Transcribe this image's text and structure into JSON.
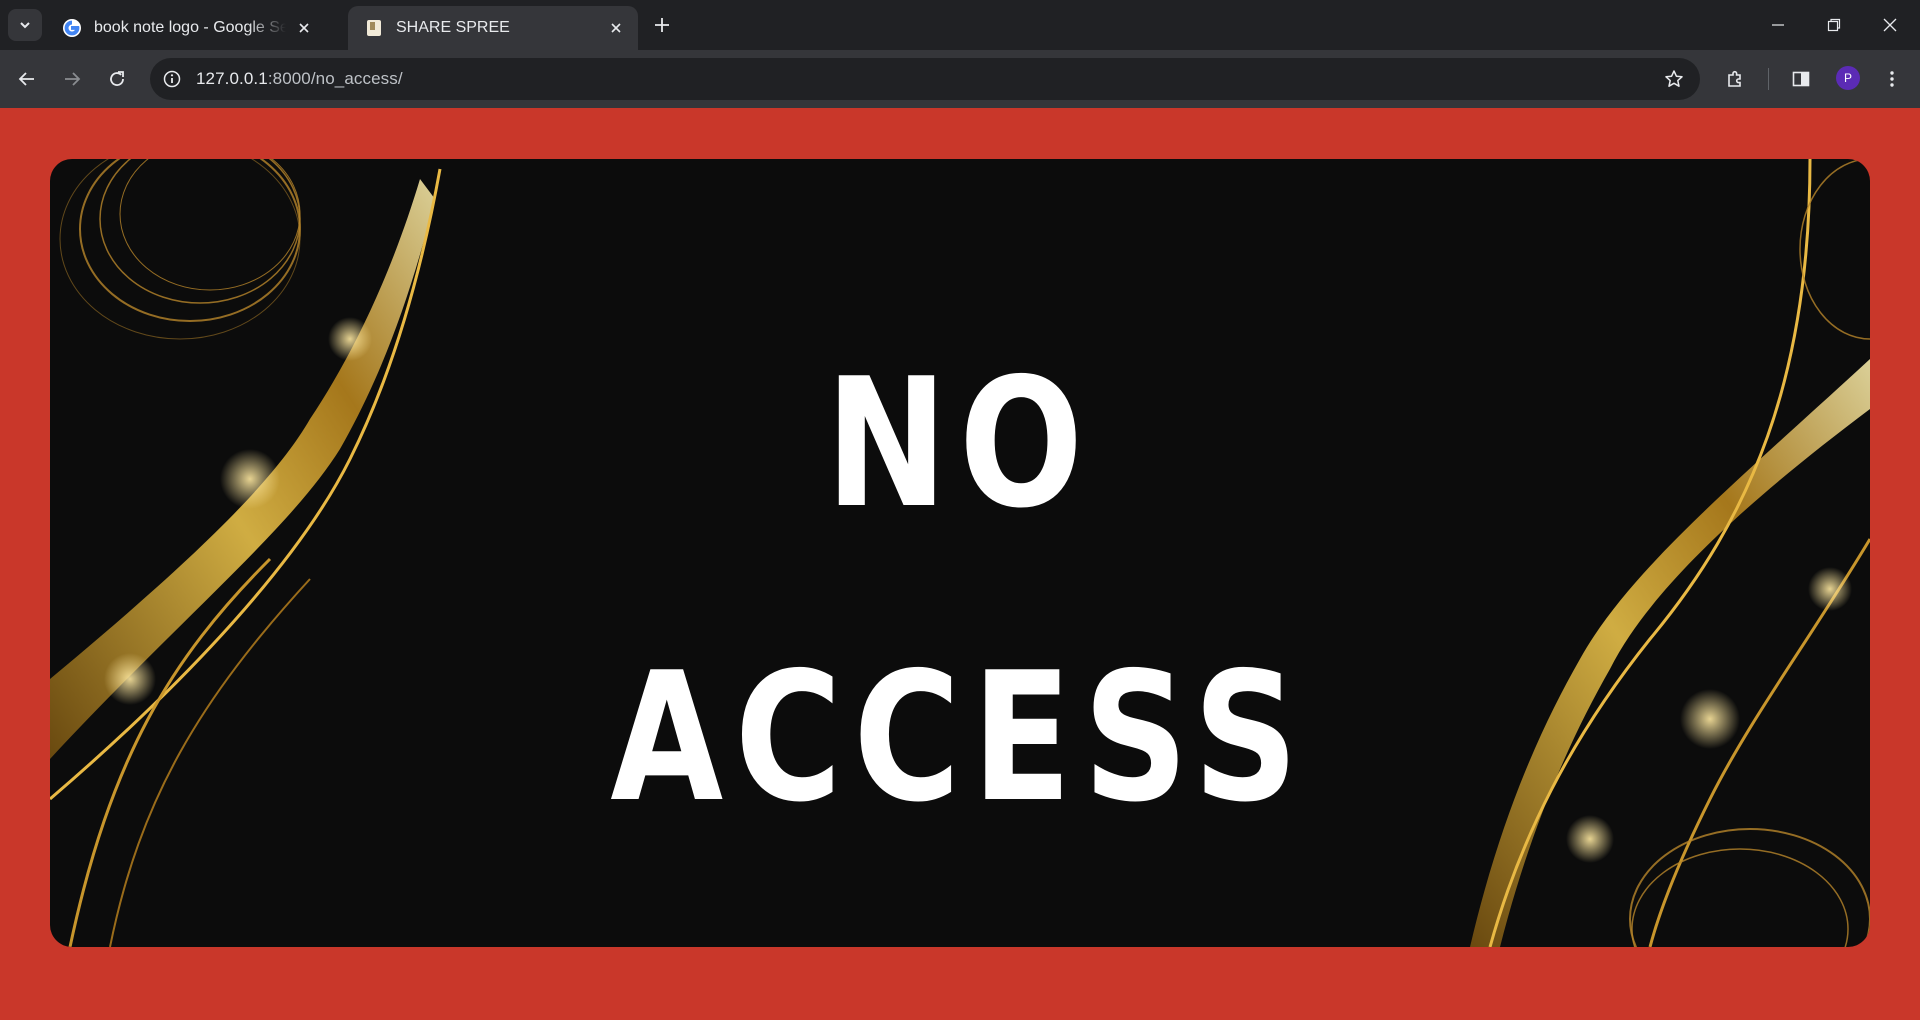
{
  "browser": {
    "tabs": [
      {
        "title": "book note logo - Google Search",
        "favicon": "google-g-icon",
        "active": false
      },
      {
        "title": "SHARE SPREE",
        "favicon": "page-icon",
        "active": true
      }
    ],
    "url_host": "127.0.0.1",
    "url_rest": ":8000/no_access/",
    "profile_initial": "P"
  },
  "page": {
    "line1": "NO",
    "line2": "ACCESS",
    "colors": {
      "background": "#c9372a",
      "banner": "#0c0c0c",
      "gold": "#d4a533",
      "text": "#ffffff"
    }
  }
}
